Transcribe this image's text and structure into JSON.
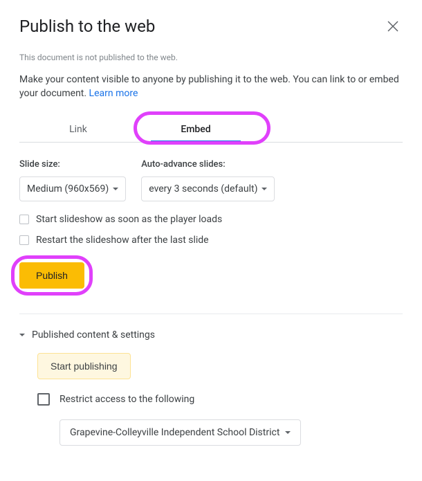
{
  "dialog": {
    "title": "Publish to the web",
    "status": "This document is not published to the web.",
    "description": "Make your content visible to anyone by publishing it to the web. You can link to or embed your document. ",
    "learn_more": "Learn more"
  },
  "tabs": {
    "link": "Link",
    "embed": "Embed"
  },
  "options": {
    "slide_size_label": "Slide size:",
    "slide_size_value": "Medium (960x569)",
    "auto_advance_label": "Auto-advance slides:",
    "auto_advance_value": "every 3 seconds (default)",
    "start_slideshow": "Start slideshow as soon as the player loads",
    "restart_slideshow": "Restart the slideshow after the last slide"
  },
  "actions": {
    "publish": "Publish",
    "start_publishing": "Start publishing"
  },
  "settings": {
    "header": "Published content & settings",
    "restrict_label": "Restrict access to the following",
    "domain_value": "Grapevine-Colleyville Independent School District"
  }
}
